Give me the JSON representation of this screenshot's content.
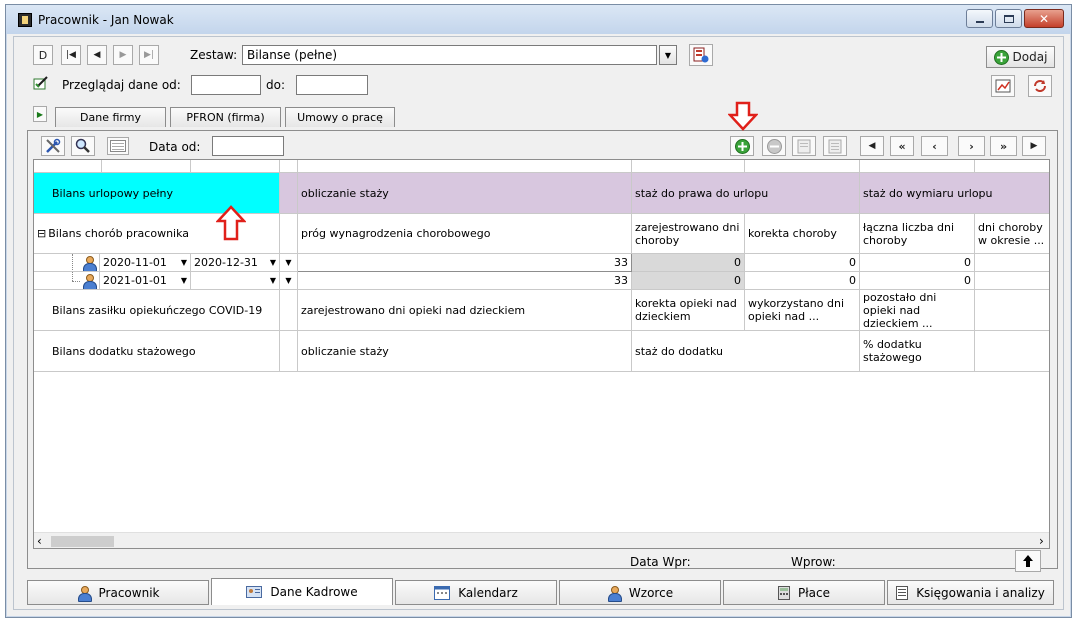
{
  "window": {
    "title": "Pracownik - Jan Nowak"
  },
  "nav": {
    "first": "D",
    "prev_first": "|◀",
    "prev": "◀",
    "next": "▶",
    "last": "▶|"
  },
  "zestaw": {
    "label": "Zestaw:",
    "value": "Bilanse (pełne)"
  },
  "przegladaj": {
    "label": "Przeglądaj dane od:",
    "od_value": "",
    "do_label": "do:",
    "do_value": ""
  },
  "dodaj_label": "Dodaj",
  "tabs": [
    {
      "label": "Dane firmy"
    },
    {
      "label": "PFRON (firma)"
    },
    {
      "label": "Umowy o pracę"
    }
  ],
  "toolbar": {
    "data_od_label": "Data od:",
    "data_od_value": ""
  },
  "grid": {
    "rows": [
      {
        "label": "Bilans urlopowy pełny",
        "cols": [
          "obliczanie staży",
          "staż do prawa do urlopu",
          "staż do wymiaru urlopu"
        ]
      },
      {
        "label": "Bilans chorób pracownika",
        "expand": "⊟",
        "cols": [
          "próg wynagrodzenia chorobowego",
          "zarejestrowano dni choroby",
          "korekta choroby",
          "łączna liczba dni choroby",
          "dni choroby w okresie ..."
        ]
      },
      {
        "label": "Bilans zasiłku opiekuńczego COVID-19",
        "cols": [
          "zarejestrowano dni opieki nad dzieckiem",
          "korekta opieki nad dzieckiem",
          "wykorzystano dni opieki nad ...",
          "pozostało dni opieki nad dzieckiem ..."
        ]
      },
      {
        "label": "Bilans dodatku stażowego",
        "cols": [
          "obliczanie staży",
          "staż do dodatku",
          "% dodatku stażowego"
        ]
      }
    ],
    "sub_rows": [
      {
        "from": "2020-11-01",
        "to": "2020-12-31",
        "v1": "33",
        "v2": "0",
        "v3": "0",
        "v4": "0"
      },
      {
        "from": "2021-01-01",
        "to": "",
        "v1": "33",
        "v2": "0",
        "v3": "0",
        "v4": "0"
      }
    ]
  },
  "status": {
    "data_wpr_label": "Data Wpr:",
    "wprow_label": "Wprow:"
  },
  "bottom_tabs": [
    {
      "label": "Pracownik"
    },
    {
      "label": "Dane Kadrowe"
    },
    {
      "label": "Kalendarz"
    },
    {
      "label": "Wzorce"
    },
    {
      "label": "Płace"
    },
    {
      "label": "Księgowania i analizy"
    }
  ],
  "colors": {
    "highlight": "#00ffff",
    "header_lavender": "#d8c7df",
    "annotation_red": "#e0201a"
  }
}
